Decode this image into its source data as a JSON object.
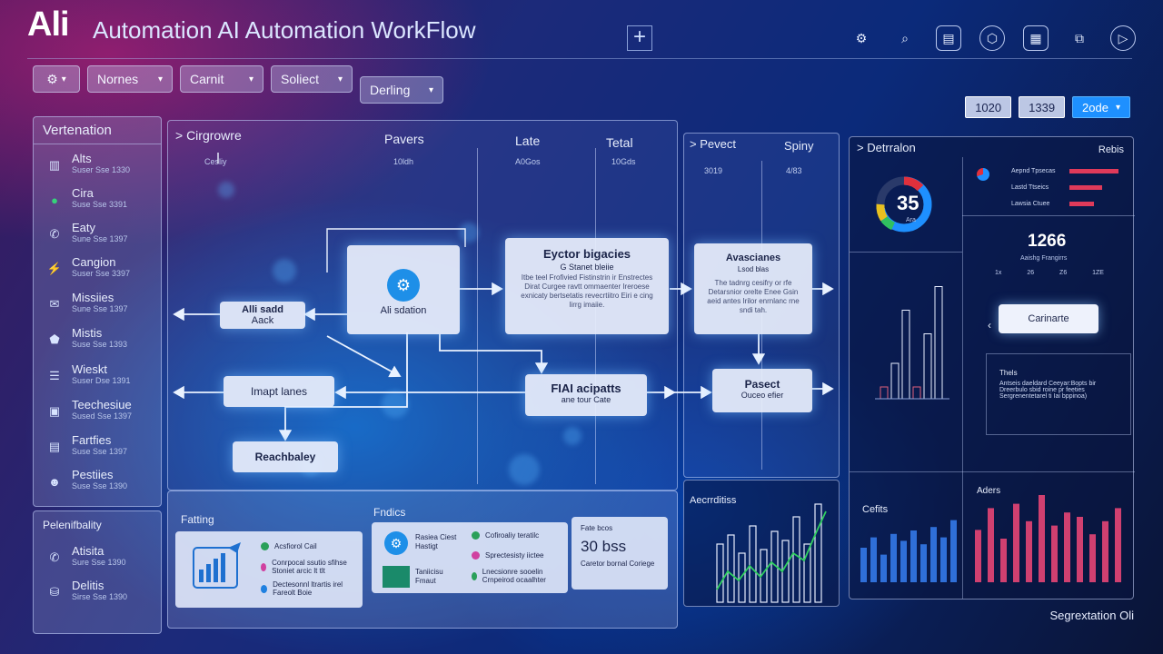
{
  "header": {
    "logo": "Ali",
    "title": "Automation AI Automation WorkFlow",
    "new_tab": "+",
    "icons": [
      "share-icon",
      "search-icon",
      "document-icon",
      "shield-icon",
      "calendar-icon",
      "puzzle-icon",
      "play-icon"
    ]
  },
  "toolbar": {
    "gear_label": "⚙",
    "dropdowns": [
      "Nornes",
      "Carnit",
      "Soliect",
      "Derling"
    ]
  },
  "right_buttons": [
    "1020",
    "1339",
    "2ode"
  ],
  "sidebar": {
    "title": "Vertenation",
    "items": [
      {
        "label": "Alts",
        "sub": "Suser Sse 1330",
        "icon": "chart-icon"
      },
      {
        "label": "Cira",
        "sub": "Suse Sse 3391",
        "icon": "chat-icon"
      },
      {
        "label": "Eaty",
        "sub": "Sune Sse 1397",
        "icon": "phone-icon"
      },
      {
        "label": "Cangion",
        "sub": "Suser Sse 3397",
        "icon": "bolt-icon"
      },
      {
        "label": "Missiies",
        "sub": "Sune Sse 1397",
        "icon": "mail-icon"
      },
      {
        "label": "Mistis",
        "sub": "Suse Sse 1393",
        "icon": "shield-icon"
      },
      {
        "label": "Wieskt",
        "sub": "Suser Dse 1391",
        "icon": "stack-icon"
      },
      {
        "label": "Teechesiue",
        "sub": "Sused Sse 1397",
        "icon": "box-icon"
      },
      {
        "label": "Fartfies",
        "sub": "Suse Sse 1397",
        "icon": "table-icon"
      },
      {
        "label": "Pestiies",
        "sub": "Suse Sse 1390",
        "icon": "user-icon"
      }
    ]
  },
  "sidebar2": {
    "title": "Pelenifbality",
    "items": [
      {
        "label": "Atisita",
        "sub": "Sure Sse 1390",
        "icon": "phone-icon"
      },
      {
        "label": "Delitis",
        "sub": "Sirse Sse 1390",
        "icon": "database-icon"
      }
    ]
  },
  "main": {
    "columns": [
      {
        "head": "> Cirgrowre",
        "sub": "Cesliy"
      },
      {
        "head": "Pavers",
        "sub": "10ldh"
      },
      {
        "head": "Late",
        "sub": "A0Gos"
      },
      {
        "head": "Tetal",
        "sub": "10Gds"
      }
    ],
    "nodes": {
      "ai_station": {
        "title": "Ali sdation"
      },
      "alli_add": {
        "title": "Alli sadd",
        "sub": "Aack"
      },
      "imapt": {
        "title": "Imapt lanes"
      },
      "reachbaley": {
        "title": "Reachbaley"
      },
      "eyctor": {
        "title": "Eyctor bigacies",
        "sub": "G Stanet bleiie",
        "desc": "Itbe teel Frofivied Fistinstrin ir Enstrectes Dirat Curgee ravtt ommaenter Ireroese exnicaty bertsetatis revecrtiitro Eiri e cing lirrg imaiie."
      },
      "fial": {
        "title": "FIAI acipatts",
        "sub": "ane tour Cate"
      }
    }
  },
  "panel2": {
    "head": "> Pevect",
    "head_right": "Spiny",
    "sub_left": "3019",
    "sub_right": "4/83",
    "nodes": {
      "avascianes": {
        "title": "Avascianes",
        "sub": "Lsod blas",
        "desc": "The tadnrg cesifry or rfe Detarsnior orelte Enee Gsin aeid antes Irilor enrnlanc rne sndi tah."
      },
      "pasect": {
        "title": "Pasect",
        "sub": "Ouceo efier"
      }
    }
  },
  "dash": {
    "title": "> Detrralon",
    "right": "Rebis",
    "gauge_value": "35",
    "gauge_sub": "Ara",
    "gauge_fraction": 0.72,
    "bars_legend": [
      {
        "label": "Aepnd Tpsecas",
        "value": 0.9
      },
      {
        "label": "Lastd Ttseics",
        "value": 0.6
      },
      {
        "label": "Lawsia Ctuee",
        "value": 0.45
      }
    ],
    "big_number": "1266",
    "big_sub": "Aaishg Frangirrs",
    "axis": [
      "1x",
      "26",
      "Z6",
      "1ZE"
    ],
    "button": "Carinarte",
    "text_box": {
      "title": "Thels",
      "lines": [
        "Antseis daeldard Ceeyar:Bopts bir",
        "Dreerbulo sbid roine pr feeties",
        "Sergrenentetarel ti Iai bppinoa)"
      ]
    },
    "bar_chart": {
      "values": [
        0.1,
        0.3,
        0.75,
        0.1,
        0.55,
        0.95
      ]
    },
    "cells": "Cefits",
    "aders": "Aders",
    "bars_blue": [
      0.5,
      0.65,
      0.4,
      0.7,
      0.6,
      0.75,
      0.55,
      0.8,
      0.65,
      0.9
    ],
    "bars_pink": [
      0.6,
      0.85,
      0.5,
      0.9,
      0.7,
      1.0,
      0.65,
      0.8,
      0.75,
      0.55,
      0.7,
      0.85
    ]
  },
  "bottom": {
    "title1": "Fatting",
    "title2": "Fndics",
    "list1": [
      {
        "label": "Acsfiorol Cail",
        "color": "#2aa05a"
      },
      {
        "label": "Conrpocal ssutio sfihse Stoniet arcic lt tlt",
        "color": "#d040a0"
      },
      {
        "label": "Dectesonnl ltrartis irel Fareolt Boie",
        "color": "#2080e0"
      }
    ],
    "list2": [
      {
        "label": "Rasiea Ciest",
        "sub": "Hastigt"
      },
      {
        "label": "Taniicisu",
        "sub": "Fmaut"
      }
    ],
    "list3": [
      {
        "label": "Cofiroaliy teratilc",
        "color": "#2aa05a"
      },
      {
        "label": "Sprectesisty iictee",
        "color": "#d040a0"
      },
      {
        "label": "Lnecsionre sooelin Crnpeirod ocaalhter",
        "color": "#2aa05a"
      }
    ],
    "card3": {
      "top": "Fate bcos",
      "big": "30 bss",
      "bottom": "Caretor bornal Coriege"
    },
    "chart_title": "Aecrrditiss"
  },
  "footer": "Segrextation Oli"
}
